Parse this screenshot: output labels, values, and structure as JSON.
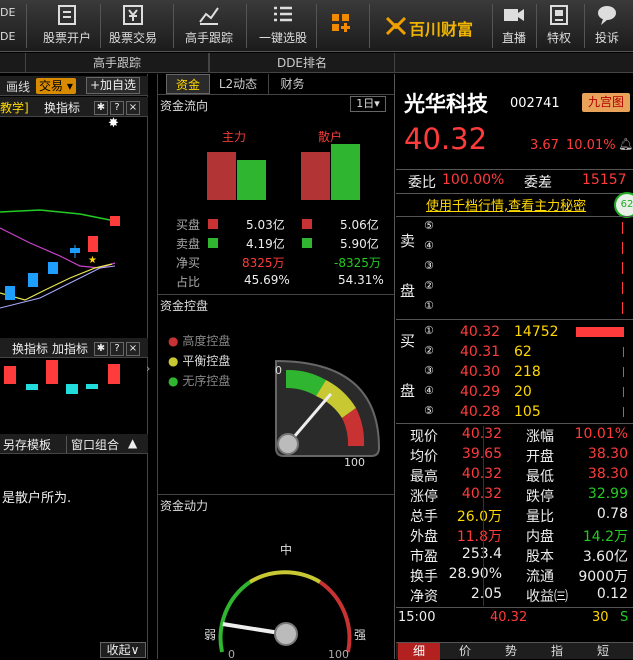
{
  "toolbar": {
    "left_cut_1": "DE",
    "left_cut_2": "DE",
    "items": [
      {
        "label": "股票开户",
        "icon": "doc-icon"
      },
      {
        "label": "股票交易",
        "icon": "yen-icon"
      },
      {
        "label": "高手跟踪",
        "icon": "chart-icon"
      },
      {
        "label": "一键选股",
        "icon": "list-icon"
      },
      {
        "label": "",
        "icon": "grid-plus-icon"
      },
      {
        "label": "直播",
        "icon": "video-icon"
      },
      {
        "label": "特权",
        "icon": "privilege-icon"
      },
      {
        "label": "投诉",
        "icon": "complaint-icon"
      }
    ],
    "brand": "百川财富"
  },
  "subtabs": [
    "高手跟踪",
    "DDE排名"
  ],
  "left": {
    "bar1": {
      "draw": "画线",
      "trade": "交易",
      "add": "+加自选"
    },
    "bar2": {
      "teach": "教学]",
      "switch": "换指标",
      "q": "?",
      "x": "×"
    },
    "bar3": {
      "switch": "换指标",
      "add": "加指标",
      "q": "?",
      "x": "×"
    },
    "bar4": {
      "save": "另存模板",
      "combo": "窗口组合",
      "up": "▲"
    },
    "note": "是散户所为.",
    "collapse": "收起"
  },
  "mid": {
    "tabs": [
      "资金",
      "L2动态",
      "财务"
    ],
    "flow_title": "资金流向",
    "period": "1日",
    "col_main": "主力",
    "col_retail": "散户",
    "rows": [
      {
        "label": "买盘",
        "main": "5.03亿",
        "retail": "5.06亿"
      },
      {
        "label": "卖盘",
        "main": "4.19亿",
        "retail": "5.90亿"
      },
      {
        "label": "净买",
        "main": "8325万",
        "retail": "-8325万"
      },
      {
        "label": "占比",
        "main": "45.69%",
        "retail": "54.31%"
      }
    ],
    "control_title": "资金控盘",
    "legend": [
      "高度控盘",
      "平衡控盘",
      "无序控盘"
    ],
    "gauge1": {
      "min": "0",
      "max": "100",
      "value": 0.45
    },
    "power_title": "资金动力",
    "gauge2": {
      "left": "弱",
      "mid": "中",
      "right": "强",
      "min": "0",
      "max": "100",
      "value": 0.05
    }
  },
  "stock": {
    "name": "光华科技",
    "code": "002741",
    "badge": "九宫图",
    "price": "40.32",
    "change": "3.67",
    "pct": "10.01%",
    "weibi_label": "委比",
    "weibi": "100.00%",
    "weicha_label": "委差",
    "weicha": "15157",
    "link": "使用千档行情,查看主力秘密",
    "float_badge": "62",
    "sell_label": [
      "卖",
      "盘"
    ],
    "buy_label": [
      "买",
      "盘"
    ],
    "sell": [
      {
        "n": "⑤",
        "p": "",
        "v": ""
      },
      {
        "n": "④",
        "p": "",
        "v": ""
      },
      {
        "n": "③",
        "p": "",
        "v": ""
      },
      {
        "n": "②",
        "p": "",
        "v": ""
      },
      {
        "n": "①",
        "p": "",
        "v": ""
      }
    ],
    "buy": [
      {
        "n": "①",
        "p": "40.32",
        "v": "14752",
        "bar": 1.0
      },
      {
        "n": "②",
        "p": "40.31",
        "v": "62",
        "bar": 0.0
      },
      {
        "n": "③",
        "p": "40.30",
        "v": "218",
        "bar": 0.0
      },
      {
        "n": "④",
        "p": "40.29",
        "v": "20",
        "bar": 0.0
      },
      {
        "n": "⑤",
        "p": "40.28",
        "v": "105",
        "bar": 0.0
      }
    ],
    "stats": [
      {
        "l1": "现价",
        "v1": "40.32",
        "c1": "red",
        "l2": "涨幅",
        "v2": "10.01%",
        "c2": "red"
      },
      {
        "l1": "均价",
        "v1": "39.65",
        "c1": "red",
        "l2": "开盘",
        "v2": "38.30",
        "c2": "red"
      },
      {
        "l1": "最高",
        "v1": "40.32",
        "c1": "red",
        "l2": "最低",
        "v2": "38.30",
        "c2": "red"
      },
      {
        "l1": "涨停",
        "v1": "40.32",
        "c1": "red",
        "l2": "跌停",
        "v2": "32.99",
        "c2": "green"
      },
      {
        "l1": "总手",
        "v1": "26.0万",
        "c1": "yellow",
        "l2": "量比",
        "v2": "0.78",
        "c2": "white"
      },
      {
        "l1": "外盘",
        "v1": "11.8万",
        "c1": "red",
        "l2": "内盘",
        "v2": "14.2万",
        "c2": "green"
      },
      {
        "l1": "市盈",
        "v1": "253.4",
        "c1": "white",
        "l2": "股本",
        "v2": "3.60亿",
        "c2": "white"
      },
      {
        "l1": "换手",
        "v1": "28.90%",
        "c1": "white",
        "l2": "流通",
        "v2": "9000万",
        "c2": "white"
      },
      {
        "l1": "净资",
        "v1": "2.05",
        "c1": "white",
        "l2": "收益㈢",
        "v2": "0.12",
        "c2": "white"
      }
    ],
    "tick": {
      "time": "15:00",
      "price": "40.32",
      "vol": "30",
      "side": "S"
    },
    "bottom_tabs": [
      "细",
      "价",
      "势",
      "指",
      "短"
    ]
  }
}
